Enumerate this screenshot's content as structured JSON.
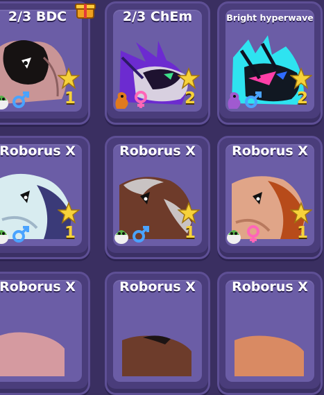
{
  "cards": [
    {
      "name": "2/3 BDC",
      "count": "1",
      "gender": "male",
      "age_icon": "egg-icon",
      "colors": {
        "body": "#c99596",
        "dark": "#1a1414"
      }
    },
    {
      "name": "2/3 ChEm",
      "count": "2",
      "gender": "female",
      "age_icon": "dragon-icon",
      "colors": {
        "body": "#d8d0e0",
        "dark": "#1e1230",
        "accent": "#7a3cd6"
      }
    },
    {
      "name": "Bright hyperwave",
      "count": "2",
      "gender": "male",
      "age_icon": "dragon-icon",
      "colors": {
        "body": "#2ee3f0",
        "dark": "#101020",
        "accent": "#ff3fa8"
      }
    },
    {
      "name": "Roborus X",
      "count": "1",
      "gender": "male",
      "age_icon": "egg-icon",
      "colors": {
        "body": "#d8ecf0",
        "dark": "#3a3a78"
      }
    },
    {
      "name": "Roborus X",
      "count": "1",
      "gender": "male",
      "age_icon": "egg-icon",
      "colors": {
        "body": "#6e3b2a",
        "dark": "#c9c3c3"
      }
    },
    {
      "name": "Roborus X",
      "count": "1",
      "gender": "female",
      "age_icon": "egg-icon",
      "colors": {
        "body": "#e0a588",
        "dark": "#b74b1a"
      }
    },
    {
      "name": "Roborus X",
      "count": "",
      "gender": "",
      "age_icon": "",
      "colors": {
        "body": "#d59aa0"
      }
    },
    {
      "name": "Roborus X",
      "count": "",
      "gender": "",
      "age_icon": "",
      "colors": {
        "body": "#6d3c2b"
      }
    },
    {
      "name": "Roborus X",
      "count": "",
      "gender": "",
      "age_icon": "",
      "colors": {
        "body": "#d98a63"
      }
    }
  ],
  "accent_colors": {
    "gold": "#f7d23a",
    "male": "#4aa3ff",
    "female": "#ff66b8"
  }
}
